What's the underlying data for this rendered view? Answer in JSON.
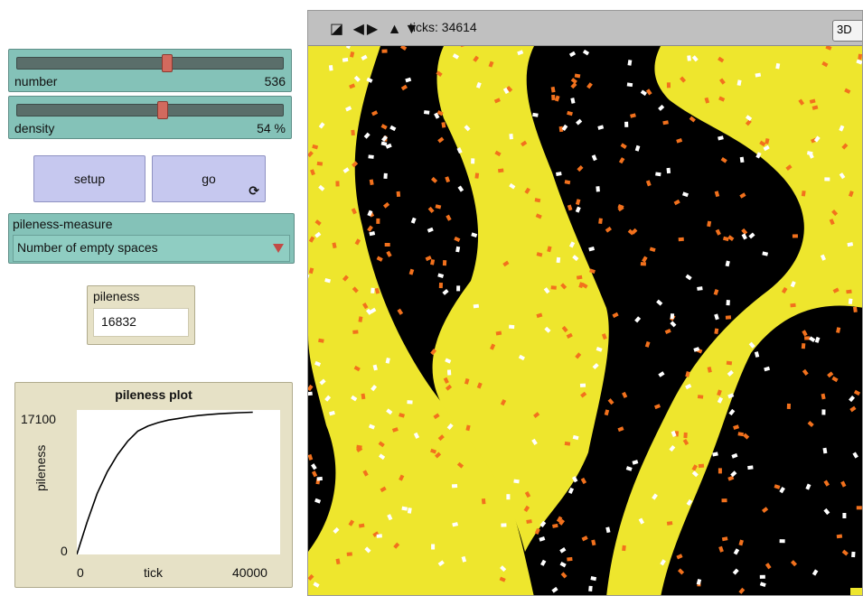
{
  "sliders": {
    "number": {
      "label": "number",
      "value": "536",
      "fraction": 0.56
    },
    "density": {
      "label": "density",
      "value": "54 %",
      "fraction": 0.54
    }
  },
  "buttons": {
    "setup": "setup",
    "go": "go",
    "go_icon": "forever-icon"
  },
  "chooser": {
    "label": "pileness-measure",
    "selected": "Number of empty spaces",
    "icon": "dropdown-arrow-icon"
  },
  "monitor": {
    "label": "pileness",
    "value": "16832"
  },
  "plot": {
    "title": "pileness plot",
    "ylabel": "pileness",
    "xlabel": "tick",
    "y_max_label": "17100",
    "y_min_label": "0",
    "x_min_label": "0",
    "x_max_label": "40000"
  },
  "chart_data": {
    "type": "line",
    "title": "pileness plot",
    "xlabel": "tick",
    "ylabel": "pileness",
    "xlim": [
      0,
      40000
    ],
    "ylim": [
      0,
      17100
    ],
    "series": [
      {
        "x": [
          0,
          2000,
          4000,
          6000,
          8000,
          10000,
          12000,
          14000,
          16000,
          18000,
          20000,
          22000,
          24000,
          26000,
          28000,
          30000,
          32000,
          34614
        ],
        "y": [
          0,
          3800,
          7200,
          9800,
          11800,
          13400,
          14600,
          15200,
          15600,
          15900,
          16100,
          16300,
          16450,
          16550,
          16650,
          16720,
          16780,
          16832
        ]
      }
    ]
  },
  "view": {
    "ticks_label": "ticks: 34614",
    "button_3d": "3D",
    "toolbar_icons": "◪ ◀▶ ▲▼",
    "colors": {
      "yellow": "#eee62d",
      "black": "#000000",
      "orange": "#f2711d",
      "white": "#ffffff"
    }
  }
}
